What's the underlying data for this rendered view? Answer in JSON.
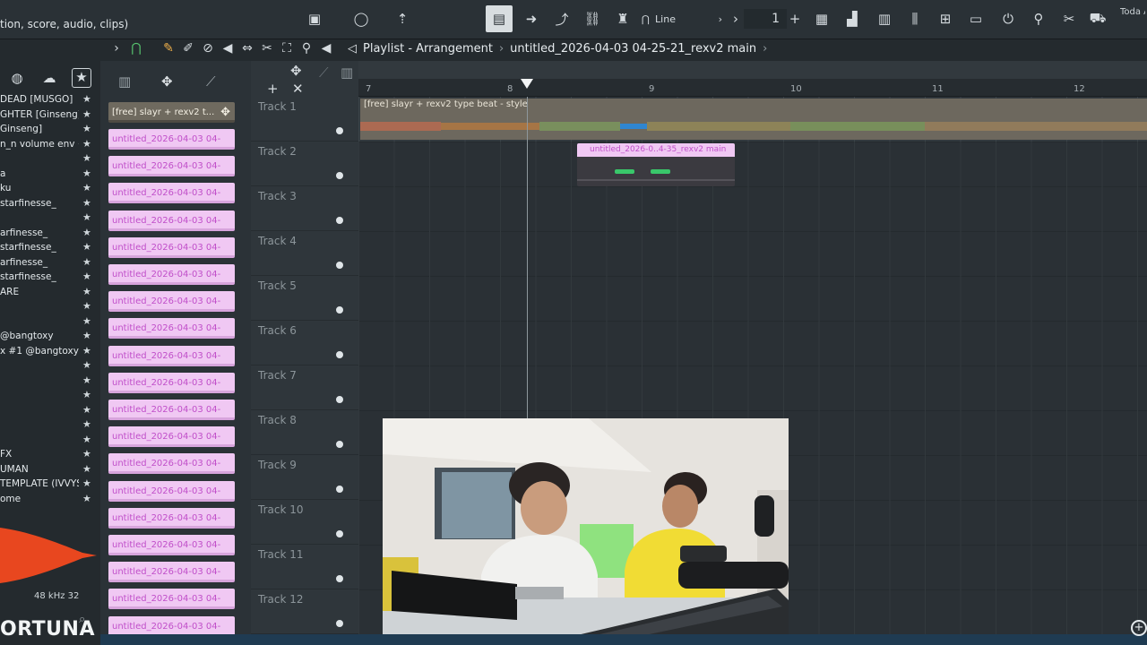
{
  "toolbar": {
    "hint": "tion, score, audio, clips)",
    "snap_label": "Line",
    "pattern_number": "1",
    "corner_text": "Toda A nev"
  },
  "playlist": {
    "title": "Playlist - Arrangement",
    "project": "untitled_2026-04-03 04-25-21_rexv2 main",
    "bar_numbers": [
      "7",
      "8",
      "9",
      "10",
      "11",
      "12"
    ]
  },
  "browser": {
    "items": [
      "DEAD [MUSGO]",
      "GHTER [Ginseng]",
      "Ginseng]",
      "n_n volume env +EQ]",
      "",
      "a",
      "ku",
      "starfinesse_",
      "",
      "arfinesse_",
      "starfinesse_",
      "arfinesse_",
      "starfinesse_",
      "ARE",
      "",
      "",
      "@bangtoxy",
      "x #1 @bangtoxy",
      "",
      "",
      "",
      "",
      "",
      "",
      "FX",
      "UMAN",
      "TEMPLATE (IVVYS)",
      "ome"
    ],
    "sample_rate": "48 kHz 32",
    "brand": "ORTUNA"
  },
  "picker": {
    "audio_clip": "[free] slayr + rexv2 t...",
    "pattern_clips": [
      "untitled_2026-04-03 04-",
      "untitled_2026-04-03 04-",
      "untitled_2026-04-03 04-",
      "untitled_2026-04-03 04-",
      "untitled_2026-04-03 04-",
      "untitled_2026-04-03 04-",
      "untitled_2026-04-03 04-",
      "untitled_2026-04-03 04-",
      "untitled_2026-04-03 04-",
      "untitled_2026-04-03 04-",
      "untitled_2026-04-03 04-",
      "untitled_2026-04-03 04-",
      "untitled_2026-04-03 04-",
      "untitled_2026-04-03 04-",
      "untitled_2026-04-03 04-",
      "untitled_2026-04-03 04-",
      "untitled_2026-04-03 04-",
      "untitled_2026-04-03 04-",
      "untitled_2026-04-03 04-"
    ]
  },
  "tracks": [
    "Track 1",
    "Track 2",
    "Track 3",
    "Track 4",
    "Track 5",
    "Track 6",
    "Track 7",
    "Track 8",
    "Track 9",
    "Track 10",
    "Track 11",
    "Track 12"
  ],
  "clips": {
    "audio_label": "[free] slayr + rexv2 type beat - style",
    "pattern_label": "untitled_2026-0..4-35_rexv2 main"
  },
  "colors": {
    "pattern_clip": "#f0c8f3",
    "audio_clip": "#6d685e",
    "note": "#39c76a",
    "accent_magnet": "#56c26e"
  }
}
